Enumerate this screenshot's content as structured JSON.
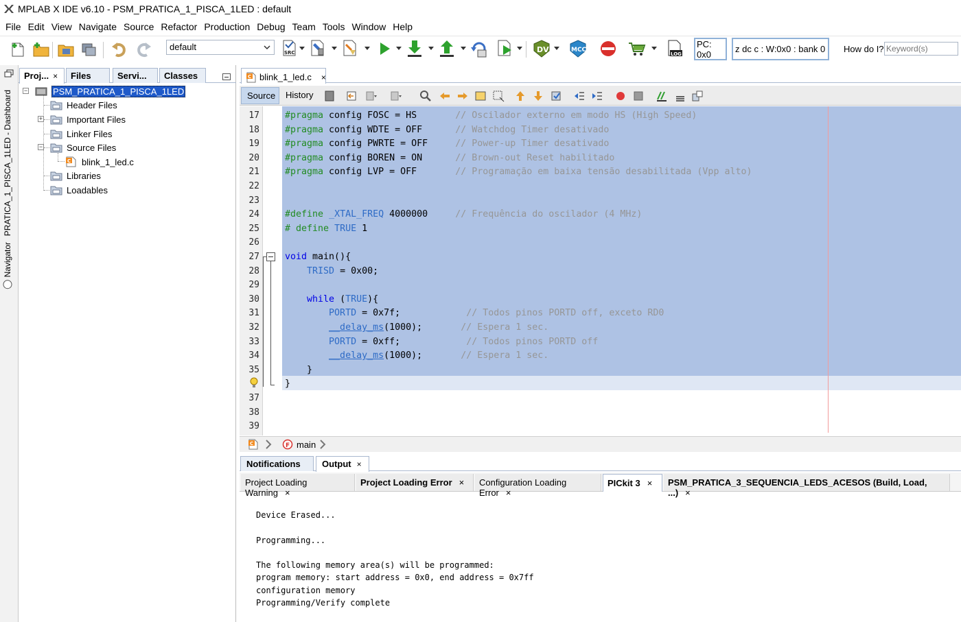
{
  "window": {
    "title": "MPLAB X IDE v6.10 - PSM_PRATICA_1_PISCA_1LED : default"
  },
  "menu": [
    "File",
    "Edit",
    "View",
    "Navigate",
    "Source",
    "Refactor",
    "Production",
    "Debug",
    "Team",
    "Tools",
    "Window",
    "Help"
  ],
  "toolbar": {
    "configuration": "default",
    "pc_value": "PC: 0x0",
    "status_register": "z dc c  : W:0x0 : bank 0",
    "howdo_label": "How do I?",
    "keyword_placeholder": "Keyword(s)"
  },
  "side_strip": {
    "dashboard": "PRATICA_1_PISCA_1LED - Dashboard",
    "navigator": "Navigator"
  },
  "project_panel": {
    "tabs": [
      "Proj...",
      "Files",
      "Servi...",
      "Classes"
    ],
    "close_glyph": "×",
    "project_name": "PSM_PRATICA_1_PISCA_1LED",
    "nodes": [
      "Header Files",
      "Important Files",
      "Linker Files",
      "Source Files",
      "blink_1_led.c",
      "Libraries",
      "Loadables"
    ]
  },
  "editor": {
    "tab_label": "blink_1_led.c",
    "source_label": "Source",
    "history_label": "History",
    "breadcrumb_function": "main",
    "line_numbers": [
      "17",
      "18",
      "19",
      "20",
      "21",
      "22",
      "23",
      "24",
      "25",
      "26",
      "27",
      "28",
      "29",
      "30",
      "31",
      "32",
      "33",
      "34",
      "35",
      "",
      "37",
      "38",
      "39"
    ],
    "lines": [
      [
        {
          "c": "pp",
          "t": "#pragma"
        },
        {
          "c": "",
          "t": " config FOSC = HS       "
        },
        {
          "c": "cm",
          "t": "// Oscilador externo em modo HS (High Speed)"
        }
      ],
      [
        {
          "c": "pp",
          "t": "#pragma"
        },
        {
          "c": "",
          "t": " config WDTE = OFF      "
        },
        {
          "c": "cm",
          "t": "// Watchdog Timer desativado"
        }
      ],
      [
        {
          "c": "pp",
          "t": "#pragma"
        },
        {
          "c": "",
          "t": " config PWRTE = OFF     "
        },
        {
          "c": "cm",
          "t": "// Power-up Timer desativado"
        }
      ],
      [
        {
          "c": "pp",
          "t": "#pragma"
        },
        {
          "c": "",
          "t": " config BOREN = ON      "
        },
        {
          "c": "cm",
          "t": "// Brown-out Reset habilitado"
        }
      ],
      [
        {
          "c": "pp",
          "t": "#pragma"
        },
        {
          "c": "",
          "t": " config LVP = OFF       "
        },
        {
          "c": "cm",
          "t": "// Programação em baixa tensão desabilitada (Vpp alto)"
        }
      ],
      [],
      [],
      [
        {
          "c": "pp",
          "t": "#define"
        },
        {
          "c": "",
          "t": " "
        },
        {
          "c": "mac",
          "t": "_XTAL_FREQ"
        },
        {
          "c": "",
          "t": " 4000000     "
        },
        {
          "c": "cm",
          "t": "// Frequência do oscilador (4 MHz)"
        }
      ],
      [
        {
          "c": "pp",
          "t": "# define"
        },
        {
          "c": "",
          "t": " "
        },
        {
          "c": "mac",
          "t": "TRUE"
        },
        {
          "c": "",
          "t": " 1"
        }
      ],
      [],
      [
        {
          "c": "kw",
          "t": "void"
        },
        {
          "c": "",
          "t": " main(){"
        }
      ],
      [
        {
          "c": "",
          "t": "    "
        },
        {
          "c": "mac",
          "t": "TRISD"
        },
        {
          "c": "",
          "t": " = 0x00;"
        }
      ],
      [],
      [
        {
          "c": "",
          "t": "    "
        },
        {
          "c": "kw",
          "t": "while"
        },
        {
          "c": "",
          "t": " ("
        },
        {
          "c": "mac",
          "t": "TRUE"
        },
        {
          "c": "",
          "t": "){"
        }
      ],
      [
        {
          "c": "",
          "t": "        "
        },
        {
          "c": "mac",
          "t": "PORTD"
        },
        {
          "c": "",
          "t": " = 0x7f;            "
        },
        {
          "c": "cm",
          "t": "// Todos pinos PORTD off, exceto RD0"
        }
      ],
      [
        {
          "c": "",
          "t": "        "
        },
        {
          "c": "fn",
          "t": "__delay_ms"
        },
        {
          "c": "",
          "t": "(1000);       "
        },
        {
          "c": "cm",
          "t": "// Espera 1 sec."
        }
      ],
      [
        {
          "c": "",
          "t": "        "
        },
        {
          "c": "mac",
          "t": "PORTD"
        },
        {
          "c": "",
          "t": " = 0xff;            "
        },
        {
          "c": "cm",
          "t": "// Todos pinos PORTD off"
        }
      ],
      [
        {
          "c": "",
          "t": "        "
        },
        {
          "c": "fn",
          "t": "__delay_ms"
        },
        {
          "c": "",
          "t": "(1000);       "
        },
        {
          "c": "cm",
          "t": "// Espera 1 sec."
        }
      ],
      [
        {
          "c": "",
          "t": "    }"
        }
      ],
      [
        {
          "c": "",
          "t": "}"
        }
      ],
      [],
      [],
      []
    ]
  },
  "output_panel": {
    "tabs": [
      "Notifications",
      "Output"
    ],
    "subtabs": [
      "Project Loading Warning",
      "Project Loading Error",
      "Configuration Loading Error",
      "PICkit 3",
      "PSM_PRATICA_3_SEQUENCIA_LEDS_ACESOS (Build, Load, ...)"
    ],
    "console": "Device Erased...\n\nProgramming...\n\nThe following memory area(s) will be programmed:\nprogram memory: start address = 0x0, end address = 0x7ff\nconfiguration memory\nProgramming/Verify complete"
  },
  "colors": {
    "selection": "#aec2e4",
    "preprocessor": "#228b22",
    "keyword": "#0000e6",
    "comment": "#969696",
    "identifier": "#2e6bc6",
    "tree_selection": "#1e59c9"
  }
}
